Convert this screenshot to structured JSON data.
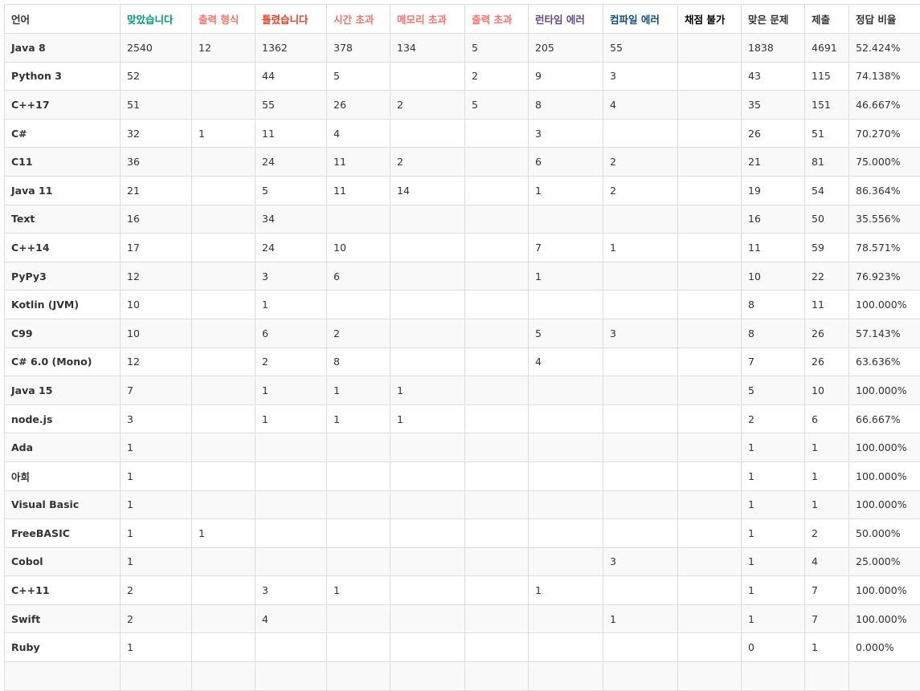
{
  "columns": [
    {
      "label": "언어",
      "color": "#333333"
    },
    {
      "label": "맞았습니다",
      "color": "#009874"
    },
    {
      "label": "출력 형식",
      "color": "#fa7268"
    },
    {
      "label": "틀렸습니다",
      "color": "#dd4124"
    },
    {
      "label": "시간 초과",
      "color": "#fa7268"
    },
    {
      "label": "메모리 초과",
      "color": "#fa7268"
    },
    {
      "label": "출력 초과",
      "color": "#fa7268"
    },
    {
      "label": "런타임 에러",
      "color": "#5f4b8b"
    },
    {
      "label": "컴파일 에러",
      "color": "#0f4c81"
    },
    {
      "label": "채점 불가",
      "color": "#000000"
    },
    {
      "label": "맞은 문제",
      "color": "#333333"
    },
    {
      "label": "제출",
      "color": "#333333"
    },
    {
      "label": "정답 비율",
      "color": "#333333"
    }
  ],
  "rows": [
    [
      "Java 8",
      "2540",
      "12",
      "1362",
      "378",
      "134",
      "5",
      "205",
      "55",
      "",
      "1838",
      "4691",
      "52.424%"
    ],
    [
      "Python 3",
      "52",
      "",
      "44",
      "5",
      "",
      "2",
      "9",
      "3",
      "",
      "43",
      "115",
      "74.138%"
    ],
    [
      "C++17",
      "51",
      "",
      "55",
      "26",
      "2",
      "5",
      "8",
      "4",
      "",
      "35",
      "151",
      "46.667%"
    ],
    [
      "C#",
      "32",
      "1",
      "11",
      "4",
      "",
      "",
      "3",
      "",
      "",
      "26",
      "51",
      "70.270%"
    ],
    [
      "C11",
      "36",
      "",
      "24",
      "11",
      "2",
      "",
      "6",
      "2",
      "",
      "21",
      "81",
      "75.000%"
    ],
    [
      "Java 11",
      "21",
      "",
      "5",
      "11",
      "14",
      "",
      "1",
      "2",
      "",
      "19",
      "54",
      "86.364%"
    ],
    [
      "Text",
      "16",
      "",
      "34",
      "",
      "",
      "",
      "",
      "",
      "",
      "16",
      "50",
      "35.556%"
    ],
    [
      "C++14",
      "17",
      "",
      "24",
      "10",
      "",
      "",
      "7",
      "1",
      "",
      "11",
      "59",
      "78.571%"
    ],
    [
      "PyPy3",
      "12",
      "",
      "3",
      "6",
      "",
      "",
      "1",
      "",
      "",
      "10",
      "22",
      "76.923%"
    ],
    [
      "Kotlin (JVM)",
      "10",
      "",
      "1",
      "",
      "",
      "",
      "",
      "",
      "",
      "8",
      "11",
      "100.000%"
    ],
    [
      "C99",
      "10",
      "",
      "6",
      "2",
      "",
      "",
      "5",
      "3",
      "",
      "8",
      "26",
      "57.143%"
    ],
    [
      "C# 6.0 (Mono)",
      "12",
      "",
      "2",
      "8",
      "",
      "",
      "4",
      "",
      "",
      "7",
      "26",
      "63.636%"
    ],
    [
      "Java 15",
      "7",
      "",
      "1",
      "1",
      "1",
      "",
      "",
      "",
      "",
      "5",
      "10",
      "100.000%"
    ],
    [
      "node.js",
      "3",
      "",
      "1",
      "1",
      "1",
      "",
      "",
      "",
      "",
      "2",
      "6",
      "66.667%"
    ],
    [
      "Ada",
      "1",
      "",
      "",
      "",
      "",
      "",
      "",
      "",
      "",
      "1",
      "1",
      "100.000%"
    ],
    [
      "아희",
      "1",
      "",
      "",
      "",
      "",
      "",
      "",
      "",
      "",
      "1",
      "1",
      "100.000%"
    ],
    [
      "Visual Basic",
      "1",
      "",
      "",
      "",
      "",
      "",
      "",
      "",
      "",
      "1",
      "1",
      "100.000%"
    ],
    [
      "FreeBASIC",
      "1",
      "1",
      "",
      "",
      "",
      "",
      "",
      "",
      "",
      "1",
      "2",
      "50.000%"
    ],
    [
      "Cobol",
      "1",
      "",
      "",
      "",
      "",
      "",
      "",
      "3",
      "",
      "1",
      "4",
      "25.000%"
    ],
    [
      "C++11",
      "2",
      "",
      "3",
      "1",
      "",
      "",
      "1",
      "",
      "",
      "1",
      "7",
      "100.000%"
    ],
    [
      "Swift",
      "2",
      "",
      "4",
      "",
      "",
      "",
      "",
      "1",
      "",
      "1",
      "7",
      "100.000%"
    ],
    [
      "Ruby",
      "1",
      "",
      "",
      "",
      "",
      "",
      "",
      "",
      "",
      "0",
      "1",
      "0.000%"
    ],
    [
      "",
      "",
      "",
      "",
      "",
      "",
      "",
      "",
      "",
      "",
      "",
      "",
      ""
    ]
  ]
}
